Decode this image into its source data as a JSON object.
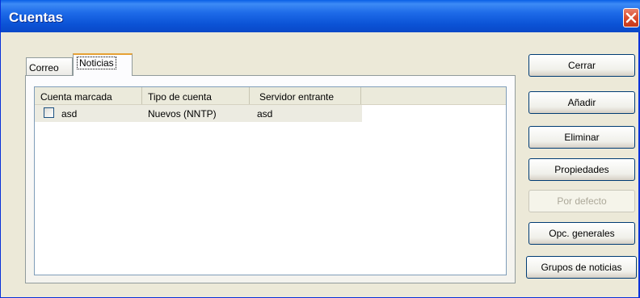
{
  "window": {
    "title": "Cuentas"
  },
  "tabs": [
    {
      "label": "Correo",
      "active": false
    },
    {
      "label": "Noticias",
      "active": true
    }
  ],
  "list": {
    "columns": [
      "Cuenta marcada",
      "Tipo de cuenta",
      "Servidor entrante"
    ],
    "rows": [
      {
        "checked": false,
        "account": "asd",
        "type": "Nuevos (NNTP)",
        "server": "asd"
      }
    ]
  },
  "buttons": {
    "close": "Cerrar",
    "add": "Añadir",
    "remove": "Eliminar",
    "properties": "Propiedades",
    "default": "Por defecto",
    "general_options": "Opc. generales",
    "newsgroups": "Grupos de noticias"
  },
  "icons": {
    "title_close": "close-icon",
    "checkbox": "checkbox-icon"
  },
  "colors": {
    "titlebar": "#0b53d6",
    "close_button": "#d94a2a",
    "dialog": "#ece9d8",
    "active_tab_accent": "#e6a134"
  }
}
